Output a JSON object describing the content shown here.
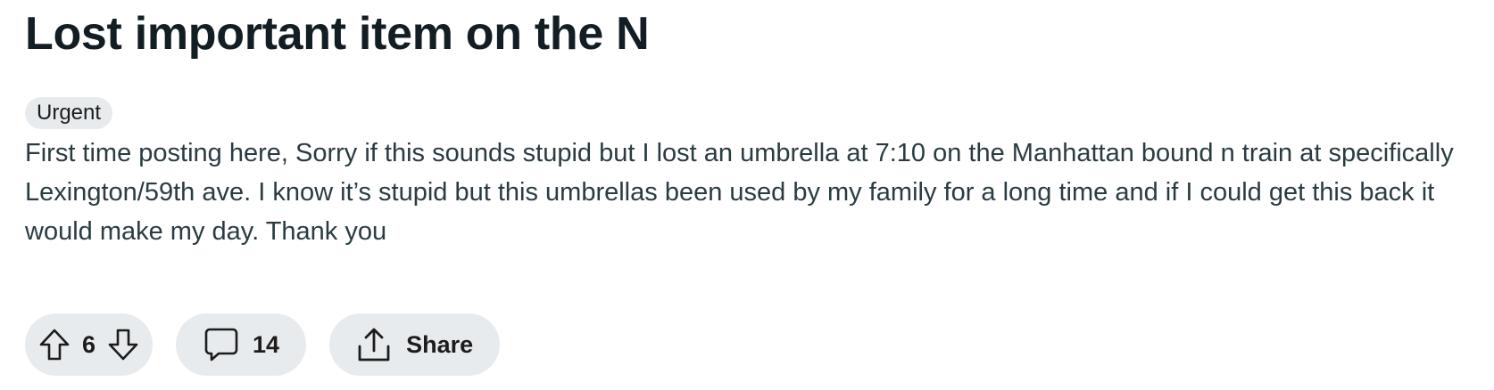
{
  "post": {
    "title": "Lost important item on the N",
    "flair": "Urgent",
    "body": "First time posting here, Sorry if this sounds stupid but I lost an umbrella at 7:10 on the Manhattan bound n train at specifically Lexington/59th ave. I know it’s stupid but this umbrellas been used by my family for a long time and if I could get this back it would make my day. Thank you"
  },
  "actions": {
    "score": "6",
    "comment_count": "14",
    "share_label": "Share"
  },
  "icons": {
    "upvote": "upvote-arrow-icon",
    "downvote": "downvote-arrow-icon",
    "comment": "comment-bubble-icon",
    "share": "share-upload-icon"
  },
  "colors": {
    "title": "#121e24",
    "body_text": "#2a3c42",
    "pill_background": "#e8ebed"
  }
}
